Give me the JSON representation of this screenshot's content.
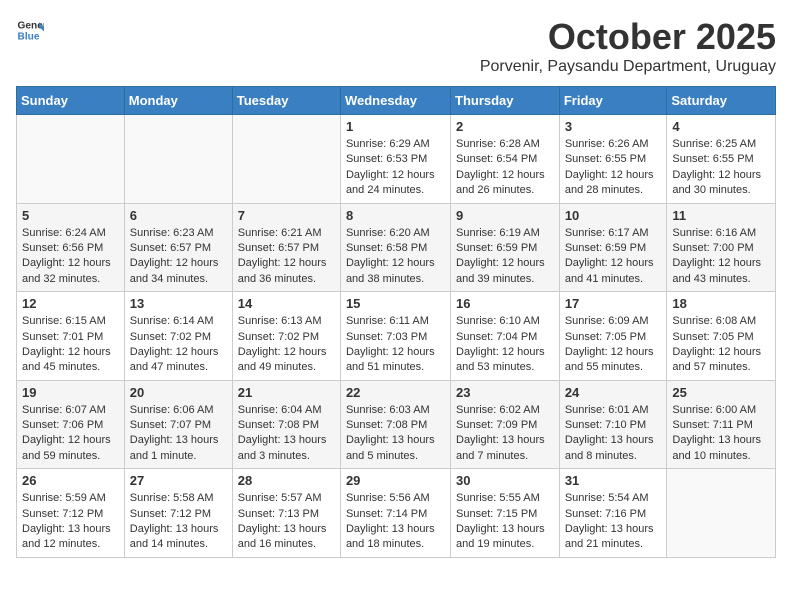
{
  "header": {
    "logo_general": "General",
    "logo_blue": "Blue",
    "month": "October 2025",
    "location": "Porvenir, Paysandu Department, Uruguay"
  },
  "weekdays": [
    "Sunday",
    "Monday",
    "Tuesday",
    "Wednesday",
    "Thursday",
    "Friday",
    "Saturday"
  ],
  "weeks": [
    [
      {
        "day": "",
        "sunrise": "",
        "sunset": "",
        "daylight": ""
      },
      {
        "day": "",
        "sunrise": "",
        "sunset": "",
        "daylight": ""
      },
      {
        "day": "",
        "sunrise": "",
        "sunset": "",
        "daylight": ""
      },
      {
        "day": "1",
        "sunrise": "Sunrise: 6:29 AM",
        "sunset": "Sunset: 6:53 PM",
        "daylight": "Daylight: 12 hours and 24 minutes."
      },
      {
        "day": "2",
        "sunrise": "Sunrise: 6:28 AM",
        "sunset": "Sunset: 6:54 PM",
        "daylight": "Daylight: 12 hours and 26 minutes."
      },
      {
        "day": "3",
        "sunrise": "Sunrise: 6:26 AM",
        "sunset": "Sunset: 6:55 PM",
        "daylight": "Daylight: 12 hours and 28 minutes."
      },
      {
        "day": "4",
        "sunrise": "Sunrise: 6:25 AM",
        "sunset": "Sunset: 6:55 PM",
        "daylight": "Daylight: 12 hours and 30 minutes."
      }
    ],
    [
      {
        "day": "5",
        "sunrise": "Sunrise: 6:24 AM",
        "sunset": "Sunset: 6:56 PM",
        "daylight": "Daylight: 12 hours and 32 minutes."
      },
      {
        "day": "6",
        "sunrise": "Sunrise: 6:23 AM",
        "sunset": "Sunset: 6:57 PM",
        "daylight": "Daylight: 12 hours and 34 minutes."
      },
      {
        "day": "7",
        "sunrise": "Sunrise: 6:21 AM",
        "sunset": "Sunset: 6:57 PM",
        "daylight": "Daylight: 12 hours and 36 minutes."
      },
      {
        "day": "8",
        "sunrise": "Sunrise: 6:20 AM",
        "sunset": "Sunset: 6:58 PM",
        "daylight": "Daylight: 12 hours and 38 minutes."
      },
      {
        "day": "9",
        "sunrise": "Sunrise: 6:19 AM",
        "sunset": "Sunset: 6:59 PM",
        "daylight": "Daylight: 12 hours and 39 minutes."
      },
      {
        "day": "10",
        "sunrise": "Sunrise: 6:17 AM",
        "sunset": "Sunset: 6:59 PM",
        "daylight": "Daylight: 12 hours and 41 minutes."
      },
      {
        "day": "11",
        "sunrise": "Sunrise: 6:16 AM",
        "sunset": "Sunset: 7:00 PM",
        "daylight": "Daylight: 12 hours and 43 minutes."
      }
    ],
    [
      {
        "day": "12",
        "sunrise": "Sunrise: 6:15 AM",
        "sunset": "Sunset: 7:01 PM",
        "daylight": "Daylight: 12 hours and 45 minutes."
      },
      {
        "day": "13",
        "sunrise": "Sunrise: 6:14 AM",
        "sunset": "Sunset: 7:02 PM",
        "daylight": "Daylight: 12 hours and 47 minutes."
      },
      {
        "day": "14",
        "sunrise": "Sunrise: 6:13 AM",
        "sunset": "Sunset: 7:02 PM",
        "daylight": "Daylight: 12 hours and 49 minutes."
      },
      {
        "day": "15",
        "sunrise": "Sunrise: 6:11 AM",
        "sunset": "Sunset: 7:03 PM",
        "daylight": "Daylight: 12 hours and 51 minutes."
      },
      {
        "day": "16",
        "sunrise": "Sunrise: 6:10 AM",
        "sunset": "Sunset: 7:04 PM",
        "daylight": "Daylight: 12 hours and 53 minutes."
      },
      {
        "day": "17",
        "sunrise": "Sunrise: 6:09 AM",
        "sunset": "Sunset: 7:05 PM",
        "daylight": "Daylight: 12 hours and 55 minutes."
      },
      {
        "day": "18",
        "sunrise": "Sunrise: 6:08 AM",
        "sunset": "Sunset: 7:05 PM",
        "daylight": "Daylight: 12 hours and 57 minutes."
      }
    ],
    [
      {
        "day": "19",
        "sunrise": "Sunrise: 6:07 AM",
        "sunset": "Sunset: 7:06 PM",
        "daylight": "Daylight: 12 hours and 59 minutes."
      },
      {
        "day": "20",
        "sunrise": "Sunrise: 6:06 AM",
        "sunset": "Sunset: 7:07 PM",
        "daylight": "Daylight: 13 hours and 1 minute."
      },
      {
        "day": "21",
        "sunrise": "Sunrise: 6:04 AM",
        "sunset": "Sunset: 7:08 PM",
        "daylight": "Daylight: 13 hours and 3 minutes."
      },
      {
        "day": "22",
        "sunrise": "Sunrise: 6:03 AM",
        "sunset": "Sunset: 7:08 PM",
        "daylight": "Daylight: 13 hours and 5 minutes."
      },
      {
        "day": "23",
        "sunrise": "Sunrise: 6:02 AM",
        "sunset": "Sunset: 7:09 PM",
        "daylight": "Daylight: 13 hours and 7 minutes."
      },
      {
        "day": "24",
        "sunrise": "Sunrise: 6:01 AM",
        "sunset": "Sunset: 7:10 PM",
        "daylight": "Daylight: 13 hours and 8 minutes."
      },
      {
        "day": "25",
        "sunrise": "Sunrise: 6:00 AM",
        "sunset": "Sunset: 7:11 PM",
        "daylight": "Daylight: 13 hours and 10 minutes."
      }
    ],
    [
      {
        "day": "26",
        "sunrise": "Sunrise: 5:59 AM",
        "sunset": "Sunset: 7:12 PM",
        "daylight": "Daylight: 13 hours and 12 minutes."
      },
      {
        "day": "27",
        "sunrise": "Sunrise: 5:58 AM",
        "sunset": "Sunset: 7:12 PM",
        "daylight": "Daylight: 13 hours and 14 minutes."
      },
      {
        "day": "28",
        "sunrise": "Sunrise: 5:57 AM",
        "sunset": "Sunset: 7:13 PM",
        "daylight": "Daylight: 13 hours and 16 minutes."
      },
      {
        "day": "29",
        "sunrise": "Sunrise: 5:56 AM",
        "sunset": "Sunset: 7:14 PM",
        "daylight": "Daylight: 13 hours and 18 minutes."
      },
      {
        "day": "30",
        "sunrise": "Sunrise: 5:55 AM",
        "sunset": "Sunset: 7:15 PM",
        "daylight": "Daylight: 13 hours and 19 minutes."
      },
      {
        "day": "31",
        "sunrise": "Sunrise: 5:54 AM",
        "sunset": "Sunset: 7:16 PM",
        "daylight": "Daylight: 13 hours and 21 minutes."
      },
      {
        "day": "",
        "sunrise": "",
        "sunset": "",
        "daylight": ""
      }
    ]
  ]
}
